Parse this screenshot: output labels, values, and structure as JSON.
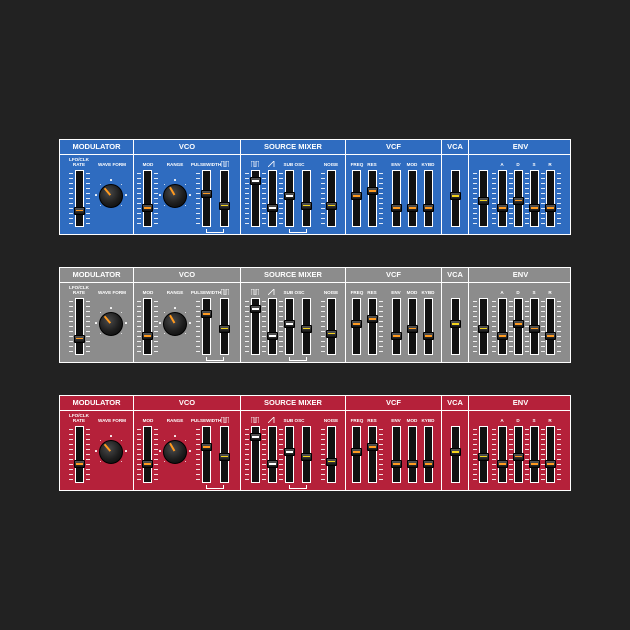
{
  "sections": {
    "modulator": "MODULATOR",
    "vco": "VCO",
    "source_mixer": "SOURCE MIXER",
    "vcf": "VCF",
    "vca": "VCA",
    "env": "ENV"
  },
  "labels": {
    "lfo_rate_1": "LFO/CLK",
    "lfo_rate_2": "RATE",
    "wave_form": "WAVE FORM",
    "mod": "MOD",
    "range": "RANGE",
    "pulsewidth": "PULSEWIDTH",
    "sub_osc": "SUB OSC",
    "noise": "NOISE",
    "freq": "FREQ",
    "res": "RES",
    "env": "ENV",
    "vcf_mod": "MOD",
    "kybd": "KYBD",
    "a": "A",
    "d": "D",
    "s": "S",
    "r": "R"
  },
  "panels": [
    {
      "name": "blue",
      "color": "#2f6cc0",
      "stripe": "#ff9a1f",
      "sliders": {
        "lfo_rate": 0.25,
        "vco_mod": 0.3,
        "pulsewidth": 0.6,
        "pwm_select": 0.35,
        "mix_square": 0.85,
        "mix_saw": 0.3,
        "mix_sub1": 0.55,
        "mix_sub2": 0.35,
        "noise": 0.35,
        "vcf_freq": 0.55,
        "vcf_res": 0.65,
        "vcf_env": 0.3,
        "vcf_mod": 0.3,
        "vcf_kybd": 0.3,
        "vca": 0.55,
        "env_trig": 0.45,
        "env_a": 0.3,
        "env_d": 0.45,
        "env_s": 0.3,
        "env_r": 0.3
      },
      "knobs": {
        "wave_form": -40,
        "range": -30
      }
    },
    {
      "name": "grey",
      "color": "#8c8c8c",
      "stripe": "#ff9a1f",
      "sliders": {
        "lfo_rate": 0.25,
        "vco_mod": 0.3,
        "pulsewidth": 0.75,
        "pwm_select": 0.45,
        "mix_square": 0.85,
        "mix_saw": 0.3,
        "mix_sub1": 0.55,
        "mix_sub2": 0.45,
        "noise": 0.35,
        "vcf_freq": 0.55,
        "vcf_res": 0.65,
        "vcf_env": 0.3,
        "vcf_mod": 0.45,
        "vcf_kybd": 0.3,
        "vca": 0.55,
        "env_trig": 0.45,
        "env_a": 0.3,
        "env_d": 0.55,
        "env_s": 0.45,
        "env_r": 0.3
      },
      "knobs": {
        "wave_form": -40,
        "range": -30
      }
    },
    {
      "name": "red",
      "color": "#b5213a",
      "stripe": "#ff9a1f",
      "sliders": {
        "lfo_rate": 0.3,
        "vco_mod": 0.3,
        "pulsewidth": 0.65,
        "pwm_select": 0.45,
        "mix_square": 0.85,
        "mix_saw": 0.3,
        "mix_sub1": 0.55,
        "mix_sub2": 0.45,
        "noise": 0.35,
        "vcf_freq": 0.55,
        "vcf_res": 0.65,
        "vcf_env": 0.3,
        "vcf_mod": 0.3,
        "vcf_kybd": 0.3,
        "vca": 0.55,
        "env_trig": 0.45,
        "env_a": 0.3,
        "env_d": 0.45,
        "env_s": 0.3,
        "env_r": 0.3
      },
      "knobs": {
        "wave_form": -40,
        "range": -30
      }
    }
  ]
}
